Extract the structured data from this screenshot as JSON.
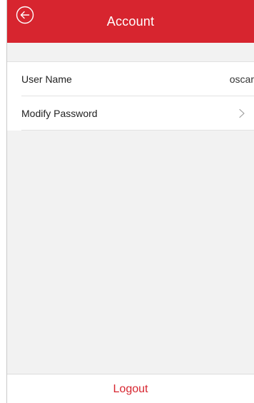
{
  "header": {
    "title": "Account",
    "back_icon": "back-circle-arrow-icon",
    "color": "#d7252f"
  },
  "rows": [
    {
      "label": "User Name",
      "value": "oscar"
    },
    {
      "label": "Modify Password",
      "icon": "chevron-right-icon"
    }
  ],
  "footer": {
    "logout_label": "Logout",
    "color": "#d7252f"
  }
}
